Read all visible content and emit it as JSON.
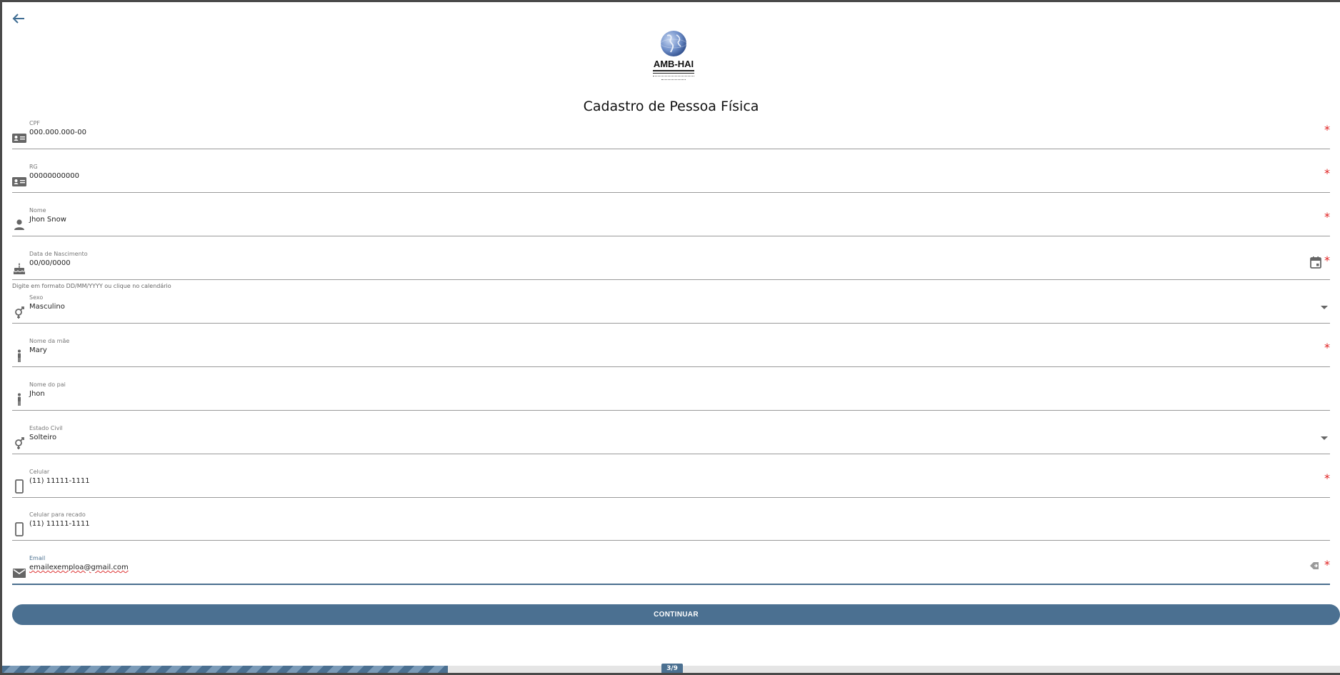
{
  "header": {
    "back_icon": "arrow-left-icon",
    "logo_text": "AMB-HAI",
    "title": "Cadastro de Pessoa Física"
  },
  "fields": {
    "cpf": {
      "label": "CPF",
      "value": "000.000.000-00",
      "icon": "id-card-icon",
      "required": true
    },
    "rg": {
      "label": "RG",
      "value": "00000000000",
      "icon": "id-card-icon",
      "required": true
    },
    "nome": {
      "label": "Nome",
      "value": "Jhon Snow",
      "icon": "person-icon",
      "required": true
    },
    "nascimento": {
      "label": "Data de Nascimento",
      "value": "00/00/0000",
      "icon": "cake-icon",
      "required": true,
      "helper": "Digite em formato DD/MM/YYYY ou clique no calendário"
    },
    "sexo": {
      "label": "Sexo",
      "value": "Masculino",
      "icon": "gender-icon"
    },
    "mae": {
      "label": "Nome da mãe",
      "value": "Mary",
      "icon": "person-standing-icon",
      "required": true
    },
    "pai": {
      "label": "Nome do pai",
      "value": "Jhon",
      "icon": "person-standing-icon"
    },
    "estado_civil": {
      "label": "Estado Civil",
      "value": "Solteiro",
      "icon": "gender-icon"
    },
    "celular": {
      "label": "Celular",
      "value": "(11) 11111-1111",
      "icon": "smartphone-icon",
      "required": true
    },
    "celular_recado": {
      "label": "Celular para recado",
      "value": "(11) 11111-1111",
      "icon": "smartphone-icon"
    },
    "email": {
      "label": "Email",
      "value": "emailexemploa@gmail.com",
      "icon": "mail-icon",
      "required": true
    }
  },
  "required_marker": "*",
  "actions": {
    "continue_label": "CONTINUAR"
  },
  "progress": {
    "label": "3/9",
    "current": 3,
    "total": 9
  },
  "colors": {
    "accent": "#4b7091",
    "required": "#e02020",
    "icon": "#666666"
  }
}
